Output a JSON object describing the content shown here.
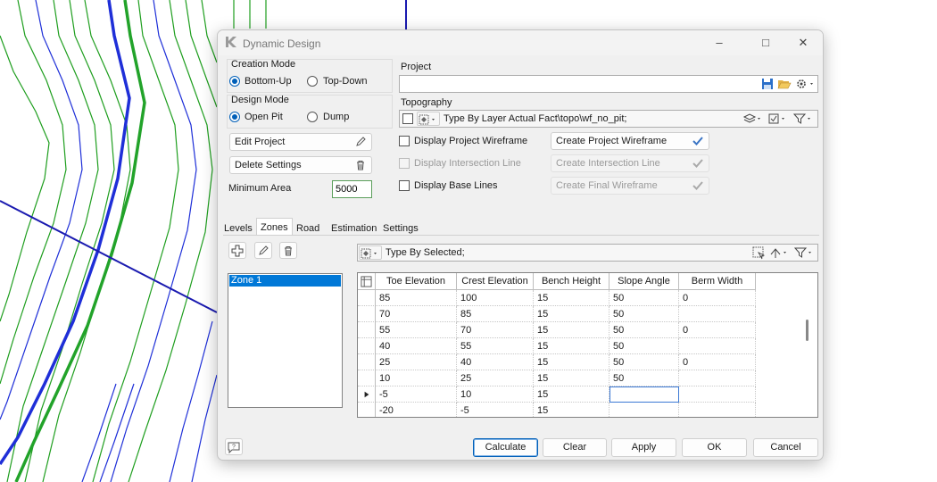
{
  "window": {
    "title": "Dynamic Design"
  },
  "creation_mode": {
    "label": "Creation Mode",
    "options": [
      "Bottom-Up",
      "Top-Down"
    ],
    "selected": "Bottom-Up"
  },
  "design_mode": {
    "label": "Design Mode",
    "options": [
      "Open Pit",
      "Dump"
    ],
    "selected": "Open Pit"
  },
  "buttons": {
    "edit_project": "Edit Project",
    "delete_settings": "Delete Settings"
  },
  "minimum_area": {
    "label": "Minimum Area",
    "value": "5000"
  },
  "project": {
    "label": "Project",
    "value": ""
  },
  "topography": {
    "label": "Topography",
    "value": "Type By Layer Actual Fact\\topo\\wf_no_pit;"
  },
  "options": [
    {
      "label": "Display Project Wireframe",
      "enabled": true,
      "button": "Create Project Wireframe"
    },
    {
      "label": "Display Intersection Line",
      "enabled": false,
      "button": "Create Intersection Line"
    },
    {
      "label": "Display Base Lines",
      "enabled": true,
      "button": "Create Final Wireframe"
    }
  ],
  "tabs": [
    "Levels",
    "Zones",
    "Road",
    "Estimation",
    "Settings"
  ],
  "active_tab": "Zones",
  "zones": [
    "Zone 1"
  ],
  "selection_filter": "Type By Selected;",
  "table": {
    "columns": [
      "Toe Elevation",
      "Crest Elevation",
      "Bench Height",
      "Slope Angle",
      "Berm Width"
    ],
    "rows": [
      [
        "85",
        "100",
        "15",
        "50",
        "0"
      ],
      [
        "70",
        "85",
        "15",
        "50",
        ""
      ],
      [
        "55",
        "70",
        "15",
        "50",
        "0"
      ],
      [
        "40",
        "55",
        "15",
        "50",
        ""
      ],
      [
        "25",
        "40",
        "15",
        "50",
        "0"
      ],
      [
        "10",
        "25",
        "15",
        "50",
        ""
      ],
      [
        "-5",
        "10",
        "15",
        "",
        ""
      ],
      [
        "-20",
        "-5",
        "15",
        "",
        ""
      ]
    ]
  },
  "footer": {
    "calculate": "Calculate",
    "clear": "Clear",
    "apply": "Apply",
    "ok": "OK",
    "cancel": "Cancel"
  },
  "colors": {
    "accent": "#005fb8",
    "contour_green": "#1e9e1e",
    "contour_blue": "#1f2fd8",
    "selection": "#0078d7"
  }
}
